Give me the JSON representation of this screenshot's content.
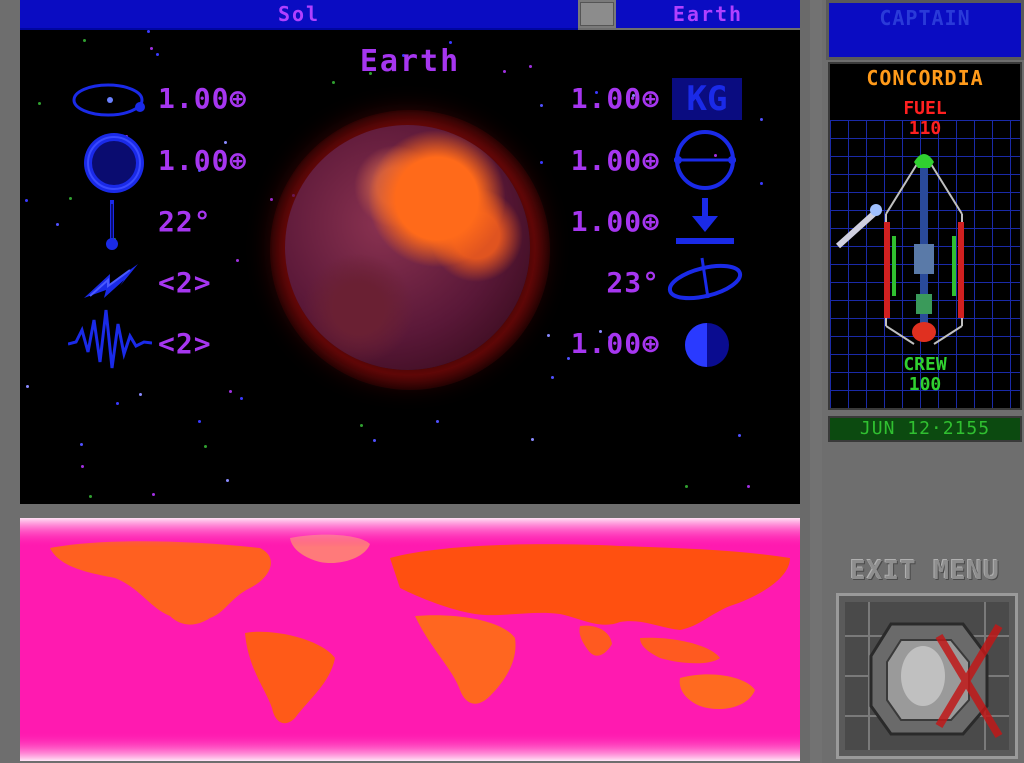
{
  "top_bar": {
    "system_name": "Sol",
    "planet_name": "Earth"
  },
  "planet": {
    "title": "Earth",
    "left_stats": [
      {
        "icon": "orbit-icon",
        "value": "1.00⊕"
      },
      {
        "icon": "planet-size-icon",
        "value": "1.00⊕"
      },
      {
        "icon": "thermometer-icon",
        "value": "22°"
      },
      {
        "icon": "lightning-icon",
        "value": "<2>"
      },
      {
        "icon": "seismic-wave-icon",
        "value": "<2>"
      }
    ],
    "right_stats": [
      {
        "icon": "mass-kg-icon",
        "value": "1.00⊕",
        "icon_text": "KG"
      },
      {
        "icon": "atmosphere-icon",
        "value": "1.00⊕"
      },
      {
        "icon": "gravity-icon",
        "value": "1.00⊕"
      },
      {
        "icon": "axial-tilt-icon",
        "value": "23°"
      },
      {
        "icon": "day-night-icon",
        "value": "1.00⊕"
      }
    ]
  },
  "side_panel": {
    "rank": "CAPTAIN",
    "ship_name": "CONCORDIA",
    "fuel_label": "FUEL",
    "fuel_value": "110",
    "crew_label": "CREW",
    "crew_value": "100",
    "date": "JUN 12·2155",
    "exit_label": "EXIT MENU"
  },
  "colors": {
    "bar_blue": "#0a0cc2",
    "stat_purple": "#a636f0",
    "icon_blue": "#1a2ae8",
    "fuel_red": "#ff2020",
    "crew_green": "#30d030",
    "ship_name_orange": "#ff9a1a",
    "map_pink": "#ff1ab0",
    "land_orange": "#ff6020"
  }
}
